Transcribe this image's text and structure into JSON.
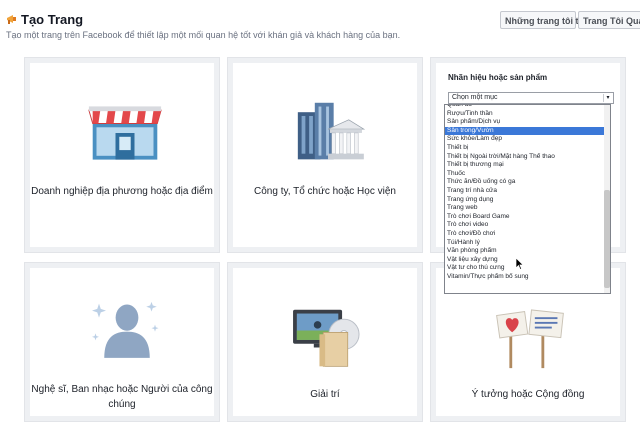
{
  "header": {
    "title": "Tạo Trang",
    "subtitle": "Tạo một trang trên Facebook để thiết lập một mối quan hệ tốt với khán giả và khách hàng của bạn.",
    "buttons": [
      "Những trang tôi thích",
      "Trang Tôi Quản Lý"
    ]
  },
  "tiles": [
    {
      "label": "Doanh nghiệp địa phương hoặc địa điểm",
      "icon": "storefront-icon"
    },
    {
      "label": "Công ty, Tổ chức hoặc Học viện",
      "icon": "office-buildings-icon"
    },
    {
      "label_line1": "Nghệ sĩ, Ban nhạc hoặc Người của công",
      "label_line2": "chúng",
      "icon": "artist-silhouette-icon"
    },
    {
      "label": "Giải trí",
      "icon": "tv-and-disc-icon"
    },
    {
      "label": "Ý tưởng hoặc Cộng đồng",
      "icon": "heart-signs-icon"
    }
  ],
  "panel": {
    "title": "Nhãn hiệu hoặc sản phẩm",
    "select_value": "Chọn một mục",
    "options": [
      "Quần áo",
      "Rượu/Tinh thần",
      "Sản phẩm/Dịch vụ",
      "Sân trong/Vườn",
      "Sức khỏe/Làm đẹp",
      "Thiết bị",
      "Thiết bị Ngoài trời/Mặt hàng Thể thao",
      "Thiết bị thương mại",
      "Thuốc",
      "Thức ăn/Đồ uống có ga",
      "Trang trí nhà cửa",
      "Trang ứng dụng",
      "Trang web",
      "Trò chơi Board Game",
      "Trò chơi video",
      "Trò chơi/Đồ chơi",
      "Túi/Hành lý",
      "Văn phòng phẩm",
      "Vật liệu xây dựng",
      "Vật tư cho thú cưng",
      "Vitamin/Thực phẩm bổ sung"
    ],
    "selected_index": 3
  },
  "colors": {
    "accent": "#3b78d8",
    "awning_red": "#e3484b",
    "tile_border": "#eef0f3"
  }
}
